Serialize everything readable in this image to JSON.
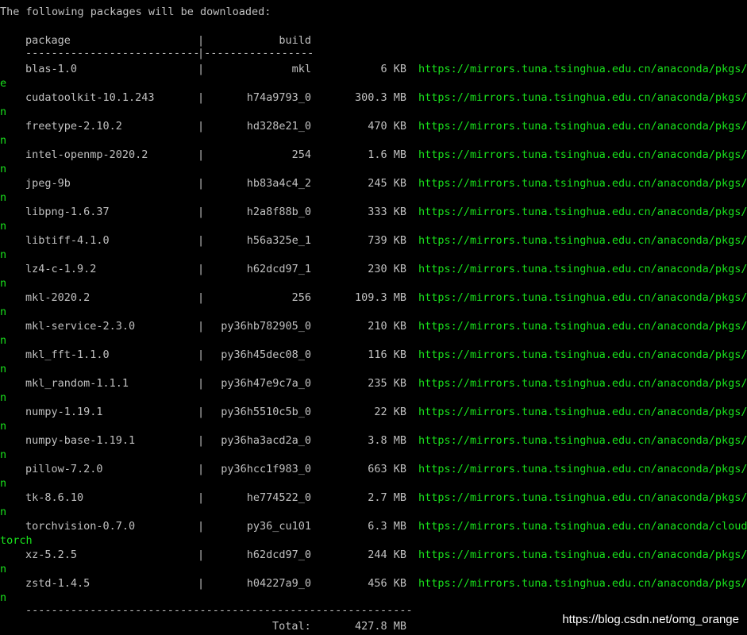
{
  "terminal": {
    "header": "The following packages will be downloaded:",
    "column_package": "package",
    "column_build": "build",
    "header_pipe": "|",
    "separator_left": "---------------------------",
    "separator_right": "|-----------------",
    "rows": [
      {
        "package": "blas-1.0",
        "build": "mkl",
        "size": "6 KB",
        "url": "https://mirrors.tuna.tsinghua.edu.cn/anaconda/pkgs/f",
        "wrap": "e"
      },
      {
        "package": "cudatoolkit-10.1.243",
        "build": "h74a9793_0",
        "size": "300.3 MB",
        "url": "https://mirrors.tuna.tsinghua.edu.cn/anaconda/pkgs/m",
        "wrap": "n"
      },
      {
        "package": "freetype-2.10.2",
        "build": "hd328e21_0",
        "size": "470 KB",
        "url": "https://mirrors.tuna.tsinghua.edu.cn/anaconda/pkgs/m",
        "wrap": "n"
      },
      {
        "package": "intel-openmp-2020.2",
        "build": "254",
        "size": "1.6 MB",
        "url": "https://mirrors.tuna.tsinghua.edu.cn/anaconda/pkgs/m",
        "wrap": "n"
      },
      {
        "package": "jpeg-9b",
        "build": "hb83a4c4_2",
        "size": "245 KB",
        "url": "https://mirrors.tuna.tsinghua.edu.cn/anaconda/pkgs/m",
        "wrap": "n"
      },
      {
        "package": "libpng-1.6.37",
        "build": "h2a8f88b_0",
        "size": "333 KB",
        "url": "https://mirrors.tuna.tsinghua.edu.cn/anaconda/pkgs/m",
        "wrap": "n"
      },
      {
        "package": "libtiff-4.1.0",
        "build": "h56a325e_1",
        "size": "739 KB",
        "url": "https://mirrors.tuna.tsinghua.edu.cn/anaconda/pkgs/m",
        "wrap": "n"
      },
      {
        "package": "lz4-c-1.9.2",
        "build": "h62dcd97_1",
        "size": "230 KB",
        "url": "https://mirrors.tuna.tsinghua.edu.cn/anaconda/pkgs/m",
        "wrap": "n"
      },
      {
        "package": "mkl-2020.2",
        "build": "256",
        "size": "109.3 MB",
        "url": "https://mirrors.tuna.tsinghua.edu.cn/anaconda/pkgs/m",
        "wrap": "n"
      },
      {
        "package": "mkl-service-2.3.0",
        "build": "py36hb782905_0",
        "size": "210 KB",
        "url": "https://mirrors.tuna.tsinghua.edu.cn/anaconda/pkgs/m",
        "wrap": "n"
      },
      {
        "package": "mkl_fft-1.1.0",
        "build": "py36h45dec08_0",
        "size": "116 KB",
        "url": "https://mirrors.tuna.tsinghua.edu.cn/anaconda/pkgs/m",
        "wrap": "n"
      },
      {
        "package": "mkl_random-1.1.1",
        "build": "py36h47e9c7a_0",
        "size": "235 KB",
        "url": "https://mirrors.tuna.tsinghua.edu.cn/anaconda/pkgs/m",
        "wrap": "n"
      },
      {
        "package": "numpy-1.19.1",
        "build": "py36h5510c5b_0",
        "size": "22 KB",
        "url": "https://mirrors.tuna.tsinghua.edu.cn/anaconda/pkgs/m",
        "wrap": "n"
      },
      {
        "package": "numpy-base-1.19.1",
        "build": "py36ha3acd2a_0",
        "size": "3.8 MB",
        "url": "https://mirrors.tuna.tsinghua.edu.cn/anaconda/pkgs/m",
        "wrap": "n"
      },
      {
        "package": "pillow-7.2.0",
        "build": "py36hcc1f983_0",
        "size": "663 KB",
        "url": "https://mirrors.tuna.tsinghua.edu.cn/anaconda/pkgs/m",
        "wrap": "n"
      },
      {
        "package": "tk-8.6.10",
        "build": "he774522_0",
        "size": "2.7 MB",
        "url": "https://mirrors.tuna.tsinghua.edu.cn/anaconda/pkgs/m",
        "wrap": "n"
      },
      {
        "package": "torchvision-0.7.0",
        "build": "py36_cu101",
        "size": "6.3 MB",
        "url": "https://mirrors.tuna.tsinghua.edu.cn/anaconda/cloud/",
        "wrap": "torch"
      },
      {
        "package": "xz-5.2.5",
        "build": "h62dcd97_0",
        "size": "244 KB",
        "url": "https://mirrors.tuna.tsinghua.edu.cn/anaconda/pkgs/m",
        "wrap": "n"
      },
      {
        "package": "zstd-1.4.5",
        "build": "h04227a9_0",
        "size": "456 KB",
        "url": "https://mirrors.tuna.tsinghua.edu.cn/anaconda/pkgs/m",
        "wrap": "n"
      }
    ],
    "footer_separator": "------------------------------------------------------------",
    "total_label": "Total:",
    "total_size": "427.8 MB"
  },
  "watermark": "https://blog.csdn.net/omg_orange",
  "colors": {
    "background": "#000000",
    "text": "#c0c0c0",
    "url": "#19e31c"
  }
}
